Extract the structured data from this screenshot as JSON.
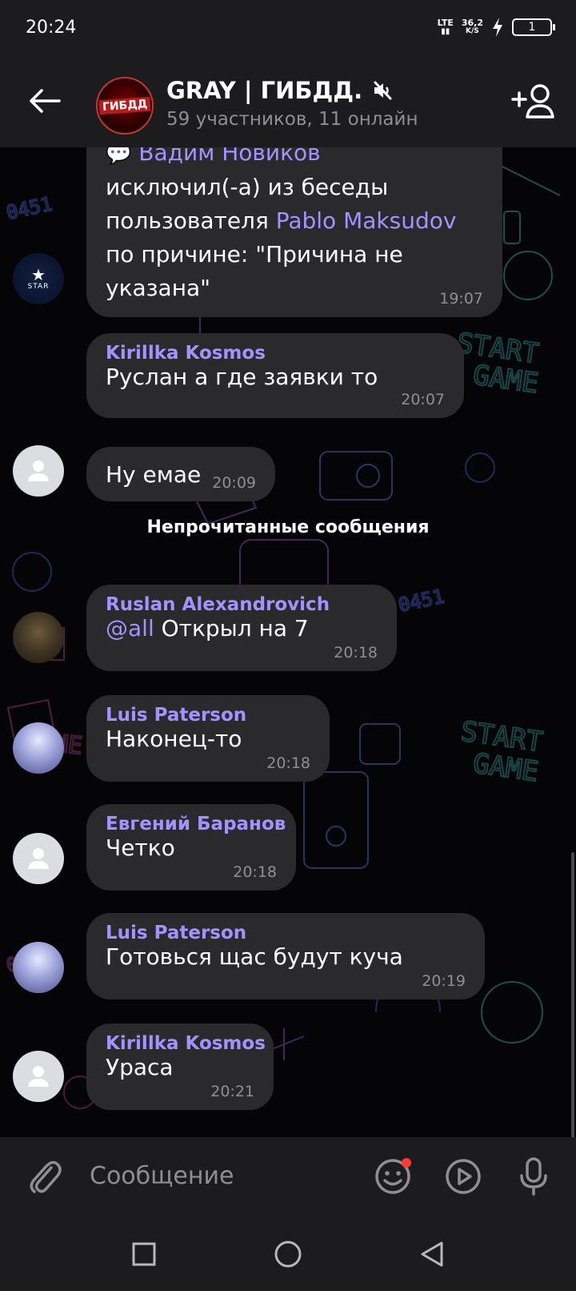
{
  "status_bar": {
    "time": "20:24",
    "network": "LTE",
    "speed_value": "36,2",
    "speed_unit": "K/S",
    "battery": "1"
  },
  "header": {
    "avatar_text": "ГИБДД",
    "title": "GRAY | ГИБДД.",
    "subtitle": "59 участников, 11 онлайн",
    "muted": true
  },
  "messages": {
    "system": {
      "sender_inline": "Вадим Новиков",
      "line1": "исключил(-а) из беседы",
      "line2_prefix": "пользователя ",
      "line2_name": "Pablo Maksudov",
      "line3": "по причине: \"Причина не",
      "line4": "указана\"",
      "time": "19:07",
      "avatar_text": "STAR"
    },
    "m1": {
      "sender": "Kirillka Kosmos",
      "text": "Руслан а где заявки то",
      "time": "20:07"
    },
    "m2": {
      "text": "Ну емае",
      "time": "20:09"
    },
    "unread_label": "Непрочитанные сообщения",
    "m3": {
      "sender": "Ruslan Alexandrovich",
      "mention": "@all",
      "text": " Открыл на 7",
      "time": "20:18"
    },
    "m4": {
      "sender": "Luis Paterson",
      "text": "Наконец-то",
      "time": "20:18"
    },
    "m5": {
      "sender": "Евгений Баранов",
      "text": "Четко",
      "time": "20:18"
    },
    "m6": {
      "sender": "Luis Paterson",
      "text": "Готовься щас будут куча",
      "time": "20:19"
    },
    "m7": {
      "sender": "Kirillka Kosmos",
      "text": "Ураса",
      "time": "20:21"
    }
  },
  "composer": {
    "placeholder": "Сообщение"
  },
  "colors": {
    "accent": "#a392ff",
    "bubble": "#2a2a2d",
    "bar": "#1c1c1e",
    "badge": "#ff3b30"
  },
  "icons": [
    "arrow-left-icon",
    "mute-icon",
    "add-member-icon",
    "paperclip-icon",
    "emoji-icon",
    "play-circle-icon",
    "microphone-icon",
    "nav-recents-icon",
    "nav-home-icon",
    "nav-back-icon"
  ]
}
